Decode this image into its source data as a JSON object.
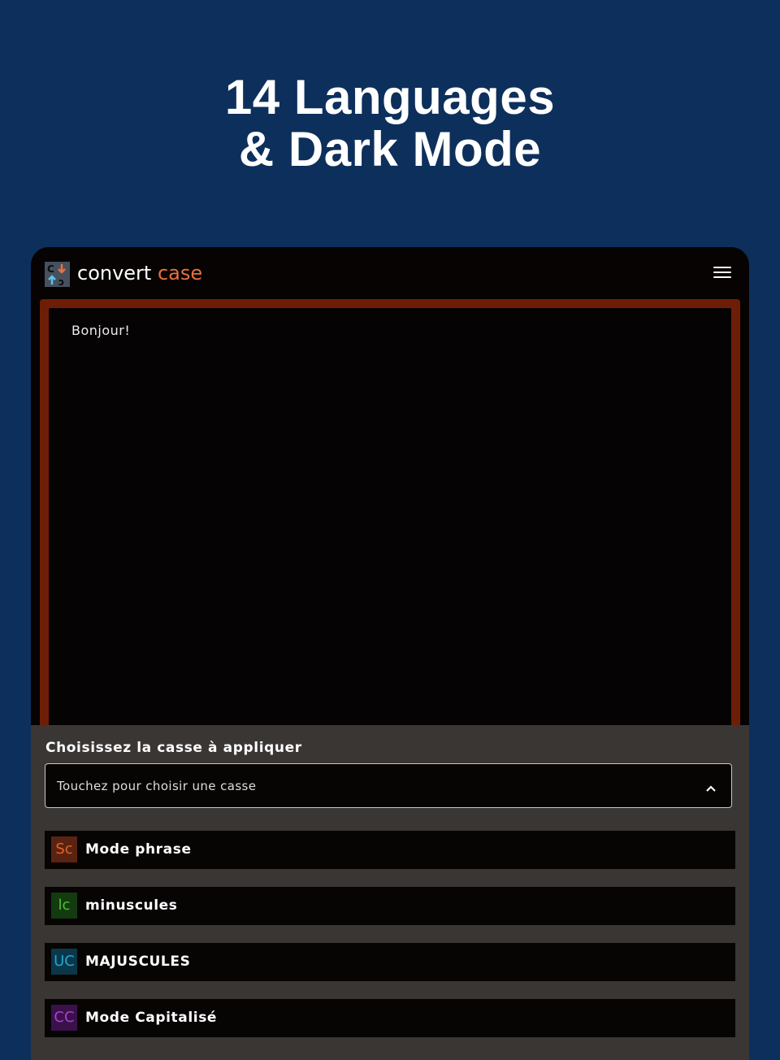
{
  "headline": {
    "line1": "14 Languages",
    "line2": "& Dark Mode"
  },
  "app": {
    "brand_part1": "convert",
    "brand_part2": "case",
    "brand_accent": "#e8703f",
    "menu_icon": "hamburger-menu-icon"
  },
  "editor": {
    "text": "Bonjour!"
  },
  "picker": {
    "label": "Choisissez la casse à appliquer",
    "placeholder": "Touchez pour choisir une casse",
    "chevron_icon": "chevron-up-icon",
    "options": [
      {
        "badge": "Sc",
        "label": "Mode phrase",
        "badge_color": "#e2622e",
        "badge_bg": "#5a2311"
      },
      {
        "badge": "lc",
        "label": "minuscules",
        "badge_color": "#4fc22d",
        "badge_bg": "#143a10"
      },
      {
        "badge": "UC",
        "label": "MAJUSCULES",
        "badge_color": "#1da7d6",
        "badge_bg": "#0b3748"
      },
      {
        "badge": "CC",
        "label": "Mode Capitalisé",
        "badge_color": "#a93fd6",
        "badge_bg": "#3a1249"
      }
    ]
  }
}
